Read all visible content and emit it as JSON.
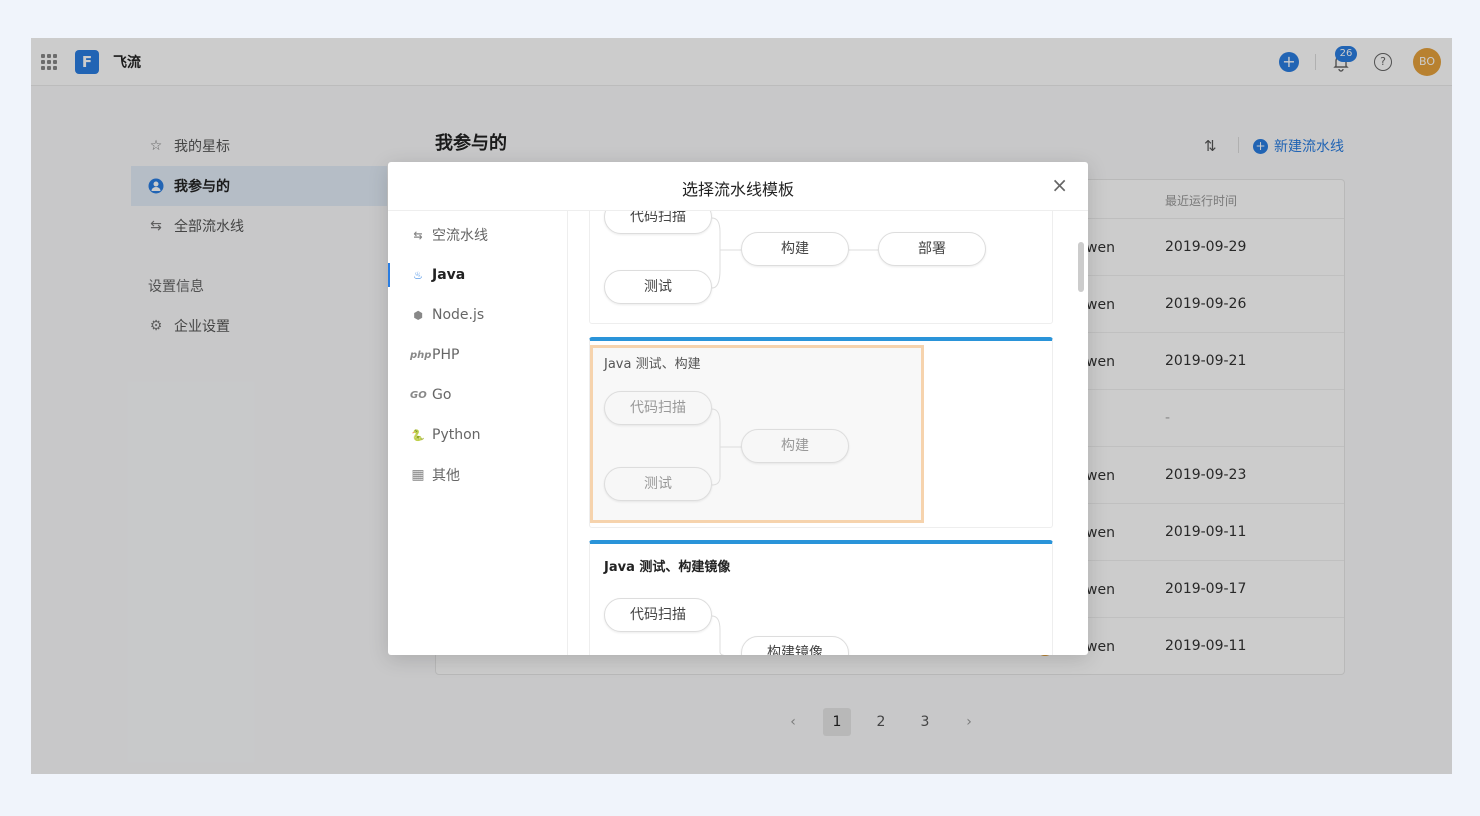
{
  "app": {
    "name": "飞流",
    "logo_letter": "F",
    "notification_count": "26",
    "user_initials": "BO",
    "help_glyph": "?",
    "add_glyph": "+"
  },
  "sidebar": {
    "items": [
      {
        "label": "我的星标",
        "icon": "star-icon"
      },
      {
        "label": "我参与的",
        "icon": "user-icon"
      },
      {
        "label": "全部流水线",
        "icon": "switch-icon"
      }
    ],
    "section": "设置信息",
    "settings_item": {
      "label": "企业设置",
      "icon": "gear-icon"
    }
  },
  "main": {
    "title": "我参与的",
    "new_button": "新建流水线",
    "table": {
      "col_time": "最近运行时间",
      "rows": [
        {
          "user": "wen",
          "time": "2019-09-29"
        },
        {
          "user": "wen",
          "time": "2019-09-26"
        },
        {
          "user": "wen",
          "time": "2019-09-21"
        },
        {
          "user": "",
          "time": "-"
        },
        {
          "user": "wen",
          "time": "2019-09-23"
        },
        {
          "user": "wen",
          "time": "2019-09-11"
        },
        {
          "user": "wen",
          "time": "2019-09-17"
        },
        {
          "user": "wen",
          "time": "2019-09-11"
        }
      ]
    },
    "pager": {
      "prev": "‹",
      "pages": [
        "1",
        "2",
        "3"
      ],
      "current": "1",
      "next": "›"
    }
  },
  "modal": {
    "title": "选择流水线模板",
    "close": "×",
    "categories": [
      {
        "label": "空流水线",
        "icon": "switch-icon",
        "glyph": "⇆"
      },
      {
        "label": "Java",
        "icon": "java-icon",
        "glyph": "♨"
      },
      {
        "label": "Node.js",
        "icon": "nodejs-icon",
        "glyph": "⬢"
      },
      {
        "label": "PHP",
        "icon": "php-icon",
        "glyph": "php"
      },
      {
        "label": "Go",
        "icon": "go-icon",
        "glyph": "GO"
      },
      {
        "label": "Python",
        "icon": "python-icon",
        "glyph": "🐍"
      },
      {
        "label": "其他",
        "icon": "grid-icon",
        "glyph": "▦"
      }
    ],
    "active_category": "Java",
    "templates": [
      {
        "title": "",
        "stages": [
          "代码扫描",
          "测试",
          "构建",
          "部署"
        ]
      },
      {
        "title": "Java 测试、构建",
        "stages": [
          "代码扫描",
          "测试",
          "构建"
        ]
      },
      {
        "title": "Java 测试、构建镜像",
        "stages": [
          "代码扫描",
          "构建镜像"
        ]
      }
    ]
  }
}
